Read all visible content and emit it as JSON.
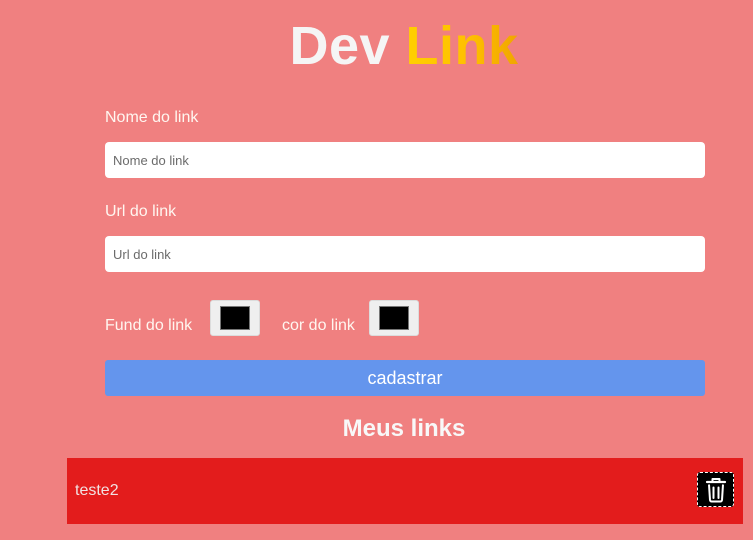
{
  "logo": {
    "part1": "Dev",
    "part2": "Link",
    "colors": {
      "part1": "#f5f5f5",
      "part2": "#ffc800"
    }
  },
  "form": {
    "name_label": "Nome do link",
    "name_placeholder": "Nome do link",
    "name_value": "",
    "url_label": "Url do link",
    "url_placeholder": "Url do link",
    "url_value": "",
    "bg_color_label": "Fund do link",
    "bg_color_value": "#000000",
    "text_color_label": "cor do link",
    "text_color_value": "#000000",
    "submit_label": "cadastrar"
  },
  "links_section": {
    "title": "Meus links",
    "items": [
      {
        "label": "teste2",
        "background": "#e31c1c",
        "delete_icon": "trash-icon"
      }
    ]
  },
  "colors": {
    "page_background": "#f08080",
    "button_background": "#6495ed",
    "link_item_background": "#e31c1c"
  }
}
